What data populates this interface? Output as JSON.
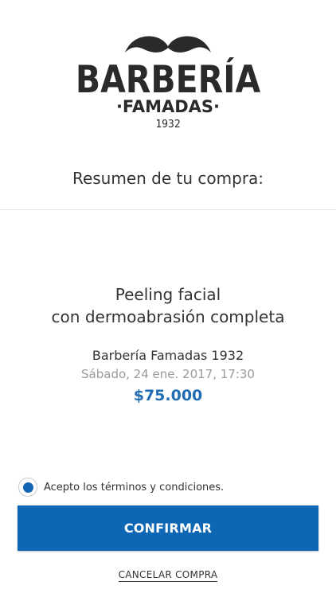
{
  "brand": {
    "main": "BARBERÍA",
    "sub": "·FAMADAS·",
    "year": "1932",
    "logo_icon": "mustache-icon"
  },
  "summary": {
    "title": "Resumen de tu compra:"
  },
  "order": {
    "service_line1": "Peeling facial",
    "service_line2": "con dermoabrasión completa",
    "shop": "Barbería Famadas 1932",
    "datetime": "Sábado, 24 ene. 2017, 17:30",
    "price": "$75.000"
  },
  "terms": {
    "label": "Acepto los términos y condiciones.",
    "checked": true
  },
  "actions": {
    "confirm_label": "CONFIRMAR",
    "cancel_label": "CANCELAR COMPRA"
  },
  "colors": {
    "accent": "#0e67b5",
    "price": "#1f6cb3"
  }
}
